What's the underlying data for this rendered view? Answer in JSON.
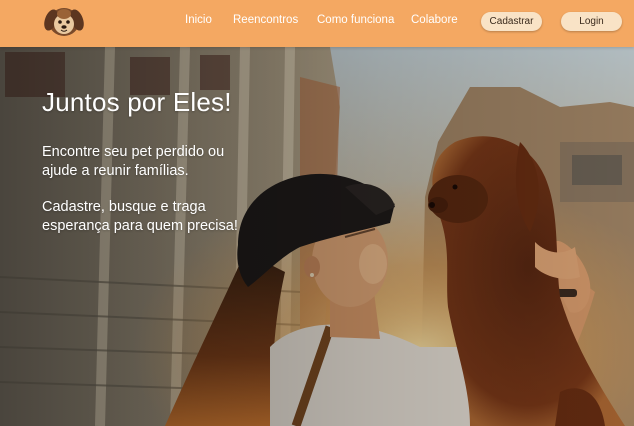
{
  "header": {
    "logo_icon": "dog-face-icon",
    "nav": [
      {
        "label": "Inicio"
      },
      {
        "label": "Reencontros"
      },
      {
        "label": "Como funciona"
      },
      {
        "label": "Colabore"
      }
    ],
    "register_label": "Cadastrar",
    "login_label": "Login"
  },
  "hero": {
    "title": "Juntos por Eles!",
    "paragraph1": "Encontre seu pet perdido ou ajude a reunir famílias.",
    "paragraph2": "Cadastre, busque e traga esperança para quem precisa!",
    "image_icon": "woman-holding-dog-photo"
  },
  "colors": {
    "header_bg": "#f4a862",
    "pill_bg": "#f9e3c6",
    "text_light": "#ffffff"
  }
}
